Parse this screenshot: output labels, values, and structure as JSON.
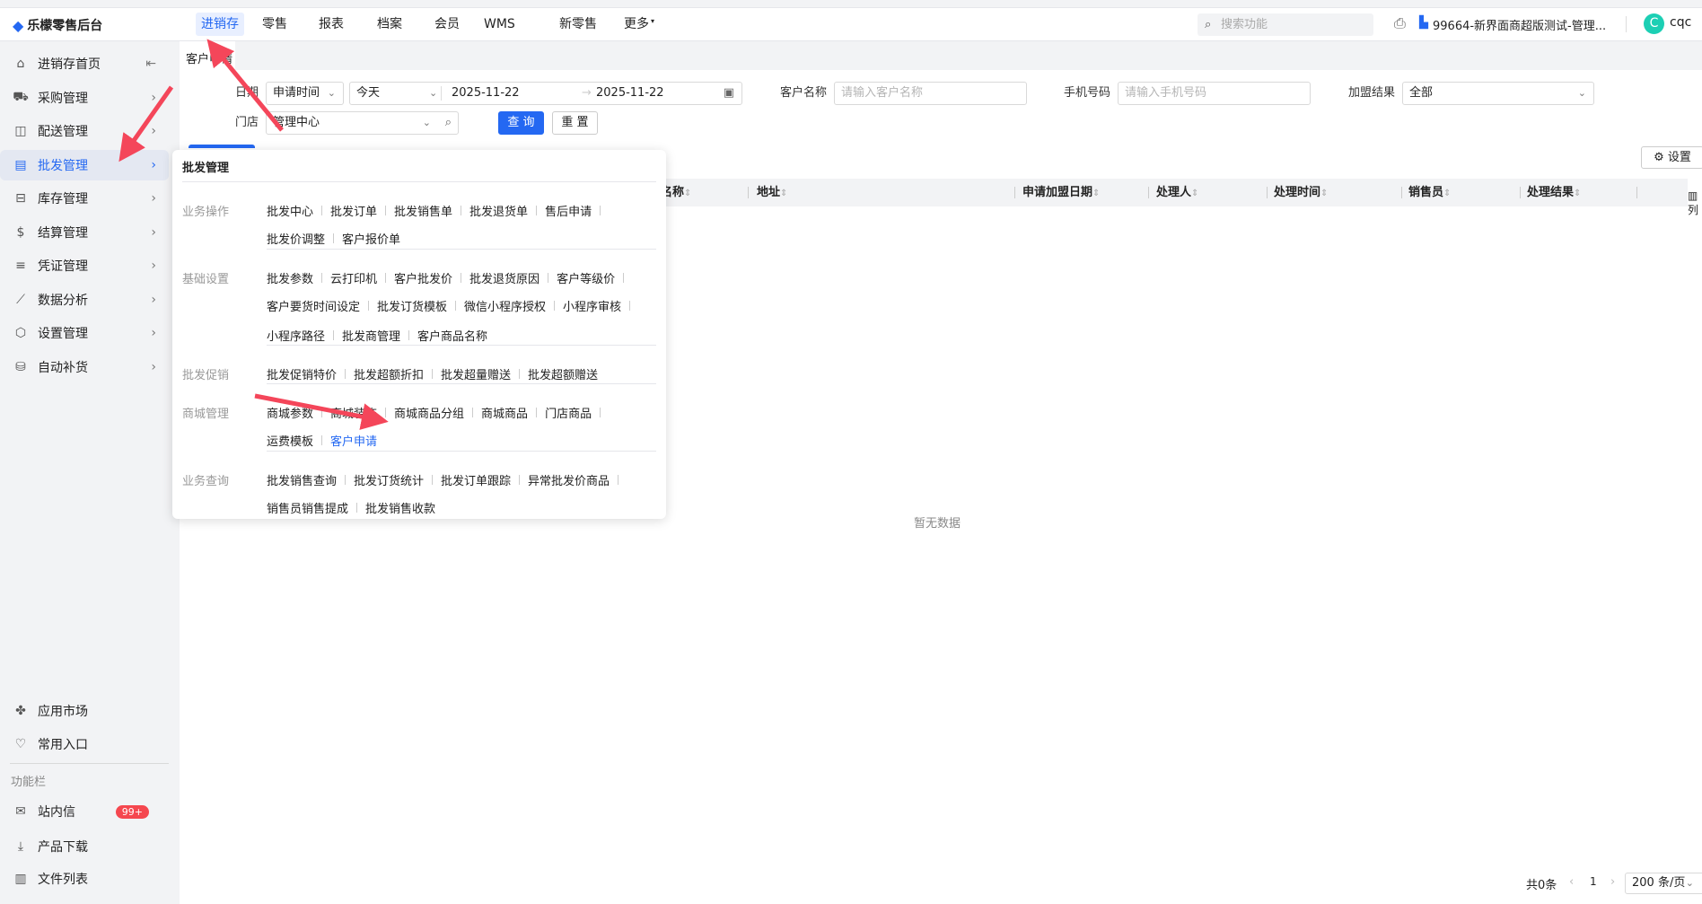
{
  "header": {
    "logo": "乐檬零售后台",
    "nav": [
      "进销存",
      "零售",
      "报表",
      "档案",
      "会员",
      "WMS",
      "新零售",
      "更多"
    ],
    "active_nav": 0,
    "search_placeholder": "搜索功能",
    "store": "99664-新界面商超版测试-管理...",
    "avatar_letter": "C",
    "user": "cqc",
    "accent": "#2468f2"
  },
  "sidebar": {
    "items": [
      {
        "label": "进销存首页",
        "icon": "home-icon"
      },
      {
        "label": "采购管理",
        "icon": "cart-icon"
      },
      {
        "label": "配送管理",
        "icon": "map-icon"
      },
      {
        "label": "批发管理",
        "icon": "wholesale-icon",
        "active": true
      },
      {
        "label": "库存管理",
        "icon": "inventory-icon"
      },
      {
        "label": "结算管理",
        "icon": "dollar-icon"
      },
      {
        "label": "凭证管理",
        "icon": "document-icon"
      },
      {
        "label": "数据分析",
        "icon": "chart-icon"
      },
      {
        "label": "设置管理",
        "icon": "settings-icon"
      },
      {
        "label": "自动补货",
        "icon": "restock-icon"
      }
    ],
    "bottom": [
      {
        "label": "应用市场",
        "icon": "app-market-icon"
      },
      {
        "label": "常用入口",
        "icon": "heart-icon"
      }
    ],
    "section_label": "功能栏",
    "tools": [
      {
        "label": "站内信",
        "icon": "mail-icon",
        "badge": "99+"
      },
      {
        "label": "产品下载",
        "icon": "download-icon"
      },
      {
        "label": "文件列表",
        "icon": "file-list-icon"
      }
    ]
  },
  "tab": "客户申请",
  "filters": {
    "date_label": "日期",
    "date_type": "申请时间",
    "date_preset": "今天",
    "date_start": "2025-11-22",
    "date_end": "2025-11-22",
    "customer_label": "客户名称",
    "customer_placeholder": "请输入客户名称",
    "phone_label": "手机号码",
    "phone_placeholder": "请输入手机号码",
    "result_label": "加盟结果",
    "result_value": "全部",
    "store_label": "门店",
    "store_value": "管理中心",
    "query": "查 询",
    "reset": "重 置"
  },
  "settings_button": "设置",
  "table": {
    "columns": [
      "名称",
      "地址",
      "申请加盟日期",
      "处理人",
      "处理时间",
      "销售员",
      "处理结果"
    ],
    "column_toggle": "列",
    "empty": "暂无数据"
  },
  "pagination": {
    "total": "共0条",
    "page": "1",
    "page_size": "200 条/页"
  },
  "popup": {
    "title": "批发管理",
    "groups": [
      {
        "label": "业务操作",
        "rows": [
          [
            "批发中心",
            "批发订单",
            "批发销售单",
            "批发退货单",
            "售后申请"
          ],
          [
            "批发价调整",
            "客户报价单"
          ]
        ]
      },
      {
        "label": "基础设置",
        "rows": [
          [
            "批发参数",
            "云打印机",
            "客户批发价",
            "批发退货原因",
            "客户等级价"
          ],
          [
            "客户要货时间设定",
            "批发订货模板",
            "微信小程序授权",
            "小程序审核"
          ],
          [
            "小程序路径",
            "批发商管理",
            "客户商品名称"
          ]
        ]
      },
      {
        "label": "批发促销",
        "rows": [
          [
            "批发促销特价",
            "批发超额折扣",
            "批发超量赠送",
            "批发超额赠送"
          ]
        ]
      },
      {
        "label": "商城管理",
        "rows": [
          [
            "商城参数",
            "商城装饰",
            "商城商品分组",
            "商城商品",
            "门店商品"
          ],
          [
            "运费模板",
            "客户申请"
          ]
        ]
      },
      {
        "label": "业务查询",
        "rows": [
          [
            "批发销售查询",
            "批发订货统计",
            "批发订单跟踪",
            "异常批发价商品"
          ],
          [
            "销售员销售提成",
            "批发销售收款"
          ]
        ]
      }
    ],
    "highlighted": "客户申请"
  }
}
